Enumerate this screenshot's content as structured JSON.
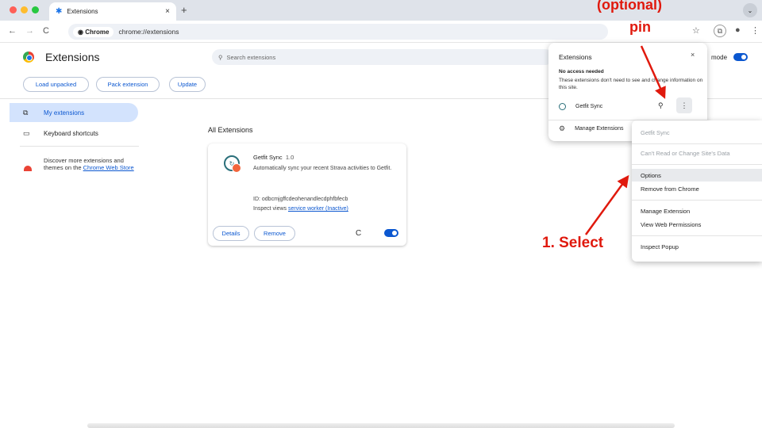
{
  "browser": {
    "tab_title": "Extensions",
    "tab_close": "×",
    "new_tab": "+",
    "tab_menu_icon": "chevron-down-icon",
    "chip_label": "Chrome",
    "url": "chrome://extensions",
    "traffic_colors": [
      "#ff5f57",
      "#febc2e",
      "#28c840"
    ]
  },
  "header": {
    "title": "Extensions",
    "search_placeholder": "Search extensions",
    "dev_mode_label": "mode",
    "dev_mode_on": true,
    "buttons": [
      "Load unpacked",
      "Pack extension",
      "Update"
    ]
  },
  "sidebar": {
    "items": [
      {
        "label": "My extensions",
        "icon": "extensions-puzzle-icon",
        "selected": true
      },
      {
        "label": "Keyboard shortcuts",
        "icon": "keyboard-icon",
        "selected": false
      }
    ],
    "discover_text": "Discover more extensions and themes on the ",
    "discover_link": "Chrome Web Store"
  },
  "main": {
    "section_title": "All Extensions",
    "extension": {
      "name": "Getfit Sync",
      "version": "1.0",
      "description": "Automatically sync your recent Strava activities to Getfit.",
      "id_label": "ID: odbcmjgffcdeohenandlecdphfbfecb",
      "views_label": "Inspect views",
      "views_link": "service worker (Inactive)",
      "details_button": "Details",
      "remove_button": "Remove",
      "enabled": true
    }
  },
  "popup": {
    "title": "Extensions",
    "close": "×",
    "no_access_title": "No access needed",
    "no_access_desc": "These extensions don't need to see and change information on this site.",
    "extension_name": "Getfit Sync",
    "manage_label": "Manage Extensions"
  },
  "context_menu": {
    "items": [
      {
        "label": "Getfit Sync",
        "disabled": true
      },
      {
        "label": "Can't Read or Change Site's Data",
        "disabled": true
      },
      {
        "label": "Options",
        "disabled": false,
        "highlighted": true
      },
      {
        "label": "Remove from Chrome",
        "disabled": false
      },
      {
        "label": "Manage Extension",
        "disabled": false
      },
      {
        "label": "View Web Permissions",
        "disabled": false
      },
      {
        "label": "Inspect Popup",
        "disabled": false
      }
    ]
  },
  "annotations": {
    "top_line1": "(optional)",
    "top_line2": "pin",
    "select": "1. Select",
    "color": "#e0190d"
  }
}
